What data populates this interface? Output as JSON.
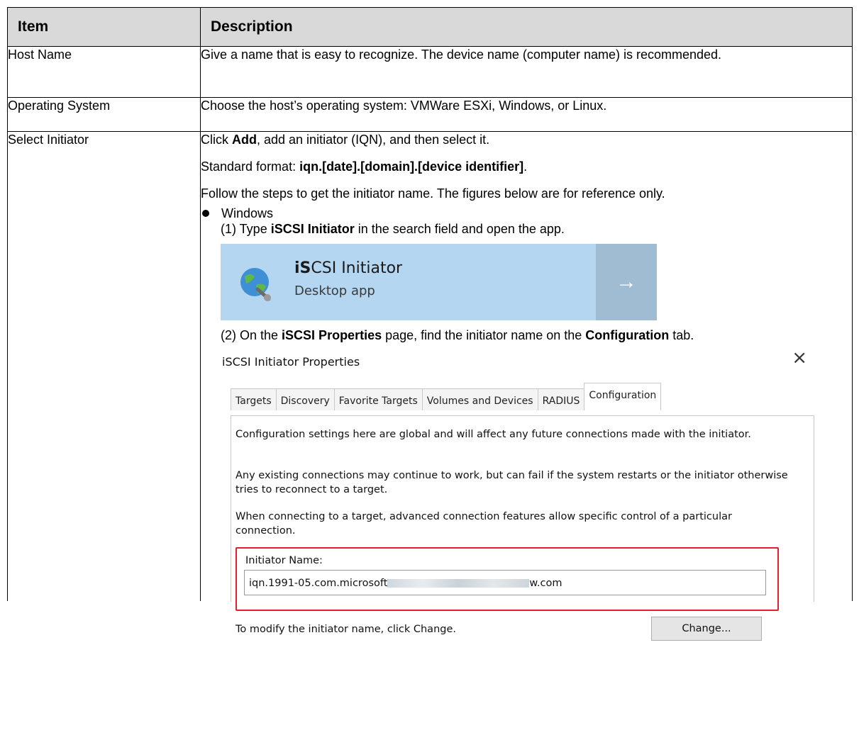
{
  "table": {
    "headers": [
      "Item",
      "Description"
    ],
    "rows": [
      {
        "item": "Host Name",
        "description": "Give a name that is easy to recognize. The device name (computer name) is recommended."
      },
      {
        "item": "Operating System",
        "description": "Choose the host’s operating system: VMWare ESXi, Windows, or Linux."
      },
      {
        "item": "Select Initiator",
        "p1_a": "Click ",
        "p1_b": "Add",
        "p1_c": ", add an initiator (IQN), and then select it.",
        "p2_a": "Standard format: ",
        "p2_b": "iqn.[date].[domain].[device identifier]",
        "p2_c": ".",
        "p3": "Follow the steps to get the initiator name. The figures below are for reference only.",
        "bullet": "Windows",
        "step1_a": "(1) Type ",
        "step1_b": "iSCSI Initiator",
        "step1_c": " in the search field and open the app.",
        "step2_a": "(2) On the ",
        "step2_b": "iSCSI Properties",
        "step2_c": " page, find the initiator name on the ",
        "step2_d": "Configuration",
        "step2_e": " tab."
      }
    ]
  },
  "search_tile": {
    "title_bold": "iS",
    "title_rest": "CSI Initiator",
    "subtitle": "Desktop app",
    "arrow": "→",
    "icon": "globe-icon"
  },
  "dialog": {
    "title": "iSCSI Initiator Properties",
    "close": "×",
    "tabs": [
      "Targets",
      "Discovery",
      "Favorite Targets",
      "Volumes and Devices",
      "RADIUS",
      "Configuration"
    ],
    "active_tab": "Configuration",
    "text1": "Configuration settings here are global and will affect any future connections made with the initiator.",
    "text2": "Any existing connections may continue to work, but can fail if the system restarts or the initiator otherwise tries to reconnect to a target.",
    "text3": "When connecting to a target, advanced connection features allow specific control of a particular connection.",
    "initiator_label": "Initiator Name:",
    "initiator_value_start": "iqn.1991-05.com.microsoft",
    "initiator_value_end": "w.com",
    "modify_text": "To modify the initiator name, click Change.",
    "change_button": "Change..."
  },
  "colors": {
    "header_bg": "#d9d9d9",
    "tile_bg": "#b4d6f0",
    "tile_arrow_bg": "#9fbcd3",
    "highlight": "#e0202a"
  }
}
